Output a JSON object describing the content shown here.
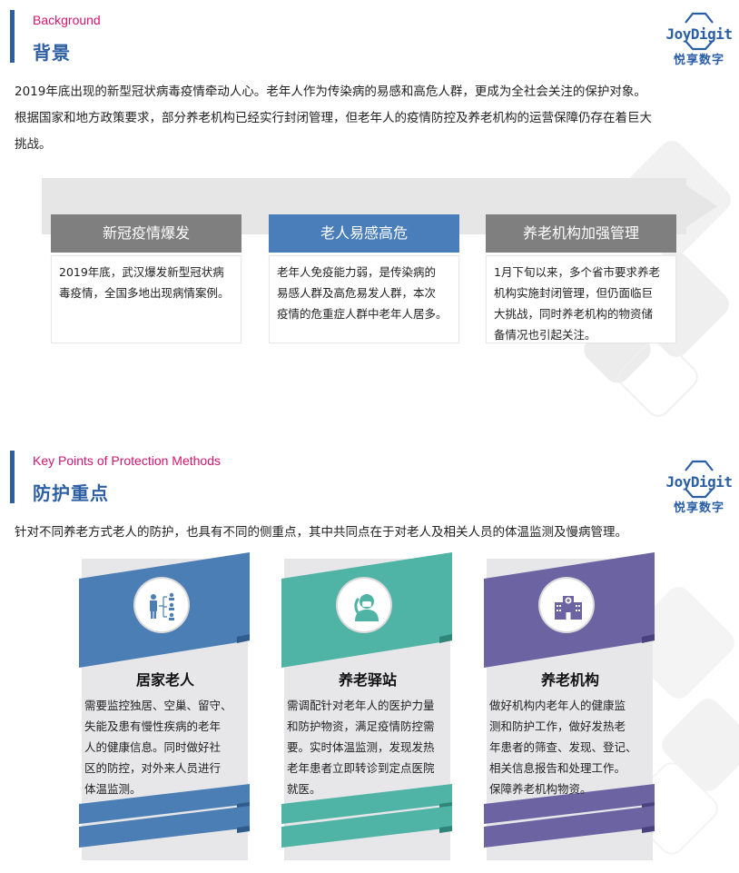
{
  "section1": {
    "title_en": "Background",
    "title_cn": "背景",
    "paragraph_lines": [
      "2019年底出现的新型冠状病毒疫情牵动人心。老年人作为传染病的易感和高危人群，更成为全社会关注的保护对象。",
      "根据国家和地方政策要求，部分养老机构已经实行封闭管理，但老年人的疫情防控及养老机构的运营保障仍存在着巨大",
      "挑战。"
    ],
    "cards": [
      {
        "title": "新冠疫情爆发",
        "color": "#7f7f7f",
        "lines": [
          "2019年底，武汉爆发新型冠状病",
          "毒疫情，全国多地出现病情案例。"
        ]
      },
      {
        "title": "老人易感高危",
        "color": "#4a7ebb",
        "lines": [
          "老年人免疫能力弱，是传染病的",
          "易感人群及高危易发人群，本次",
          "疫情的危重症人群中老年人居多。"
        ]
      },
      {
        "title": "养老机构加强管理",
        "color": "#7f7f7f",
        "lines": [
          "1月下旬以来，多个省市要求养老",
          "机构实施封闭管理，但仍面临巨",
          "大挑战，同时养老机构的物资储",
          "备情况也引起关注。"
        ]
      }
    ]
  },
  "section2": {
    "title_en": "Key Points of Protection Methods",
    "title_cn": "防护重点",
    "paragraph": "针对不同养老方式老人的防护，也具有不同的侧重点，其中共同点在于对老人及相关人员的体温监测及慢病管理。",
    "cards": [
      {
        "title": "居家老人",
        "icon": "family-tree-icon",
        "color": "#4a7eb5",
        "lines": [
          "需要监控独居、空巢、留守、",
          "失能及患有慢性疾病的老年",
          "人的健康信息。同时做好社",
          "区的防控，对外来人员进行",
          "体温监测。"
        ]
      },
      {
        "title": "养老驿站",
        "icon": "doctor-phone-icon",
        "color": "#4fb3a5",
        "lines": [
          "需调配针对老年人的医护力量",
          "和防护物资，满足疫情防控需",
          "要。实时体温监测，发现发热",
          "老年患者立即转诊到定点医院",
          "就医。"
        ]
      },
      {
        "title": "养老机构",
        "icon": "hospital-icon",
        "color": "#6c63a3",
        "lines": [
          "做好机构内老年人的健康监",
          "测和防护工作，做好发热老",
          "年患者的筛查、发现、登记、",
          "相关信息报告和处理工作。",
          "保障养老机构物资。"
        ]
      }
    ]
  },
  "logo": {
    "text_en": "JoyDigit",
    "text_cn": "悦享数字",
    "color": "#2a5ea5"
  },
  "accent_colors": {
    "header_bar": "#2e5fa3",
    "english_title": "#d0166f"
  }
}
